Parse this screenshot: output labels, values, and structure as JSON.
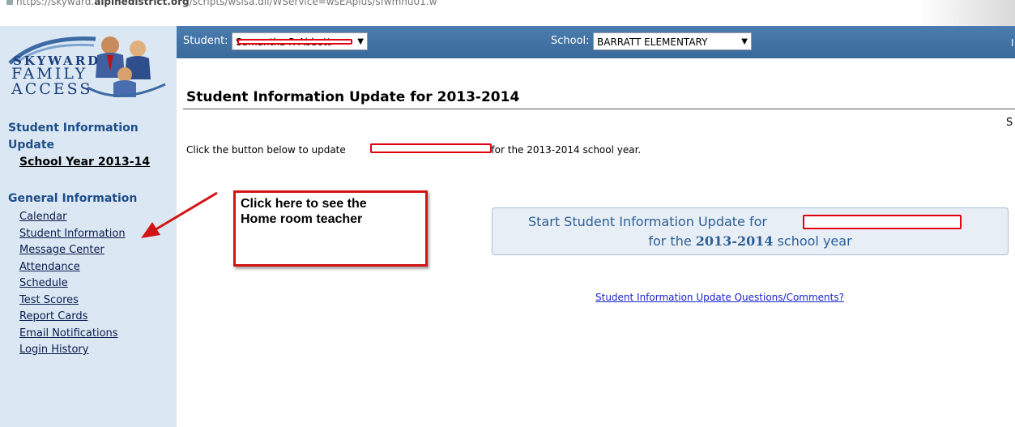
{
  "browser": {
    "url_prefix": "https://skyward.",
    "url_domain": "alpinedistrict.org",
    "url_path": "/scripts/wsisa.dll/WService=wsEAplus/sfwmnu01.w"
  },
  "logo": {
    "line1": "SKYWARD",
    "line2": "FAMILY",
    "line3": "ACCESS"
  },
  "header": {
    "student_label": "Student:",
    "student_value": "Samantha R Abbott",
    "school_label": "School:",
    "school_value": "BARRATT ELEMENTARY",
    "edge_char": "I"
  },
  "sidebar": {
    "section1_title": "Student Information Update",
    "section1_item": "School Year 2013-14",
    "section2_title": "General Information",
    "items": [
      "Calendar",
      "Student Information",
      "Message Center",
      "Attendance",
      "Schedule",
      "Test Scores",
      "Report Cards",
      "Email Notifications",
      "Login History"
    ]
  },
  "main": {
    "title": "Student Information Update for 2013-2014",
    "edge_char": "S",
    "instruction_before": "Click the button below to update",
    "instruction_after": "for the 2013-2014 school year.",
    "button_line1": "Start Student Information Update for",
    "button_line2_pre": "for the",
    "button_line2_year": "2013-2014",
    "button_line2_post": "school year",
    "link": "Student Information Update Questions/Comments?"
  },
  "annotation": {
    "text_line1": "Click here to see the",
    "text_line2": "Home room teacher"
  },
  "colors": {
    "sidebar_bg": "#dbe8f3",
    "header_bg": "#4a7cae",
    "heading_blue": "#1d4e8a",
    "annotation_red": "#d31414"
  }
}
